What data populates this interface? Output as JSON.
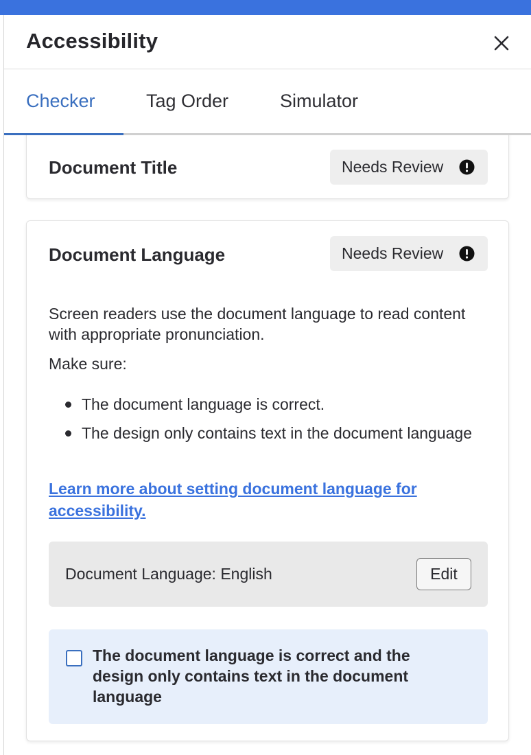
{
  "colors": {
    "accent": "#3a72de",
    "tab_active": "#3a6fbf",
    "badge_bg": "#eeeeee",
    "info_bg": "#e7effb",
    "text": "#2a2a2f"
  },
  "panel": {
    "title": "Accessibility",
    "close_icon": "close-icon"
  },
  "tabs": [
    {
      "label": "Checker",
      "active": true
    },
    {
      "label": "Tag Order",
      "active": false
    },
    {
      "label": "Simulator",
      "active": false
    }
  ],
  "cards": {
    "document_title": {
      "title": "Document Title",
      "status": "Needs Review",
      "status_icon": "alert-circle-icon"
    },
    "document_language": {
      "title": "Document Language",
      "status": "Needs Review",
      "status_icon": "alert-circle-icon",
      "description": "Screen readers use the document language to read content with appropriate pronunciation.",
      "make_sure": "Make sure:",
      "checklist": [
        "The document language is correct.",
        "The design only contains text in the document language"
      ],
      "learn_more_link": "Learn more about setting document language for accessibility.",
      "language_label": "Document Language: English",
      "edit_label": "Edit",
      "confirm_text": "The document language is correct and the design only contains text in the document language",
      "confirm_checked": false
    }
  }
}
